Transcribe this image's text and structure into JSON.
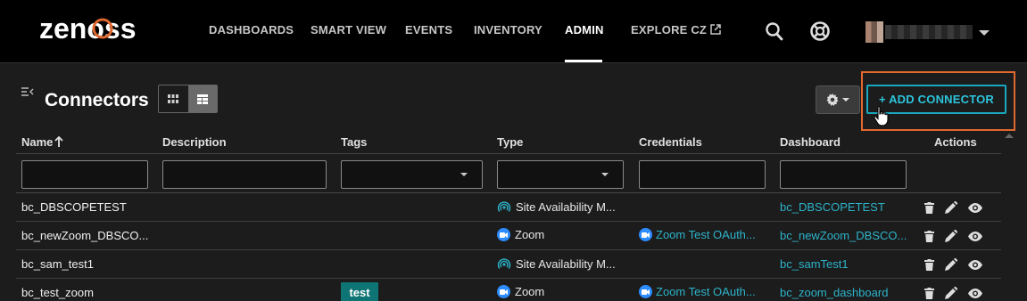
{
  "brand": {
    "logo_text": "zenoss",
    "accent": "#e1682e"
  },
  "nav": {
    "items": [
      {
        "label": "DASHBOARDS"
      },
      {
        "label": "SMART VIEW"
      },
      {
        "label": "EVENTS"
      },
      {
        "label": "INVENTORY"
      },
      {
        "label": "ADMIN",
        "active": true
      },
      {
        "label": "EXPLORE CZ",
        "icon": "external-link-icon"
      }
    ],
    "icons": [
      "search-icon",
      "help-lifebuoy-icon"
    ],
    "user_menu_icon": "chevron-down-icon"
  },
  "page": {
    "title": "Connectors",
    "add_button_label": "+ ADD CONNECTOR",
    "view_toggle": [
      "grid-view-icon",
      "table-view-icon"
    ],
    "settings_icon": "gear-icon"
  },
  "table": {
    "columns": [
      "Name",
      "Description",
      "Tags",
      "Type",
      "Credentials",
      "Dashboard",
      "Actions"
    ],
    "sort": {
      "column": "Name",
      "direction": "ascending"
    },
    "filters": {
      "description": "",
      "tags": "",
      "type": "",
      "credentials": "",
      "dashboard": "",
      "name": ""
    },
    "rows": [
      {
        "name": "bc_DBSCOPETEST",
        "tags": "",
        "type": "Site Availability M...",
        "type_icon": "site-availability-icon",
        "credentials": "",
        "dashboard": "bc_DBSCOPETEST"
      },
      {
        "name": "bc_newZoom_DBSCO...",
        "tags": "",
        "type": "Zoom",
        "type_icon": "zoom-icon",
        "credentials": "Zoom Test OAuth...",
        "dashboard": "bc_newZoom_DBSCO..."
      },
      {
        "name": "bc_sam_test1",
        "tags": "",
        "type": "Site Availability M...",
        "type_icon": "site-availability-icon",
        "credentials": "",
        "dashboard": "bc_samTest1"
      },
      {
        "name": "bc_test_zoom",
        "tags": "test",
        "type": "Zoom",
        "type_icon": "zoom-icon",
        "credentials": "Zoom Test OAuth...",
        "dashboard": "bc_zoom_dashboard"
      }
    ],
    "row_actions": [
      "trash-icon",
      "edit-pencil-icon",
      "view-eye-icon"
    ]
  }
}
